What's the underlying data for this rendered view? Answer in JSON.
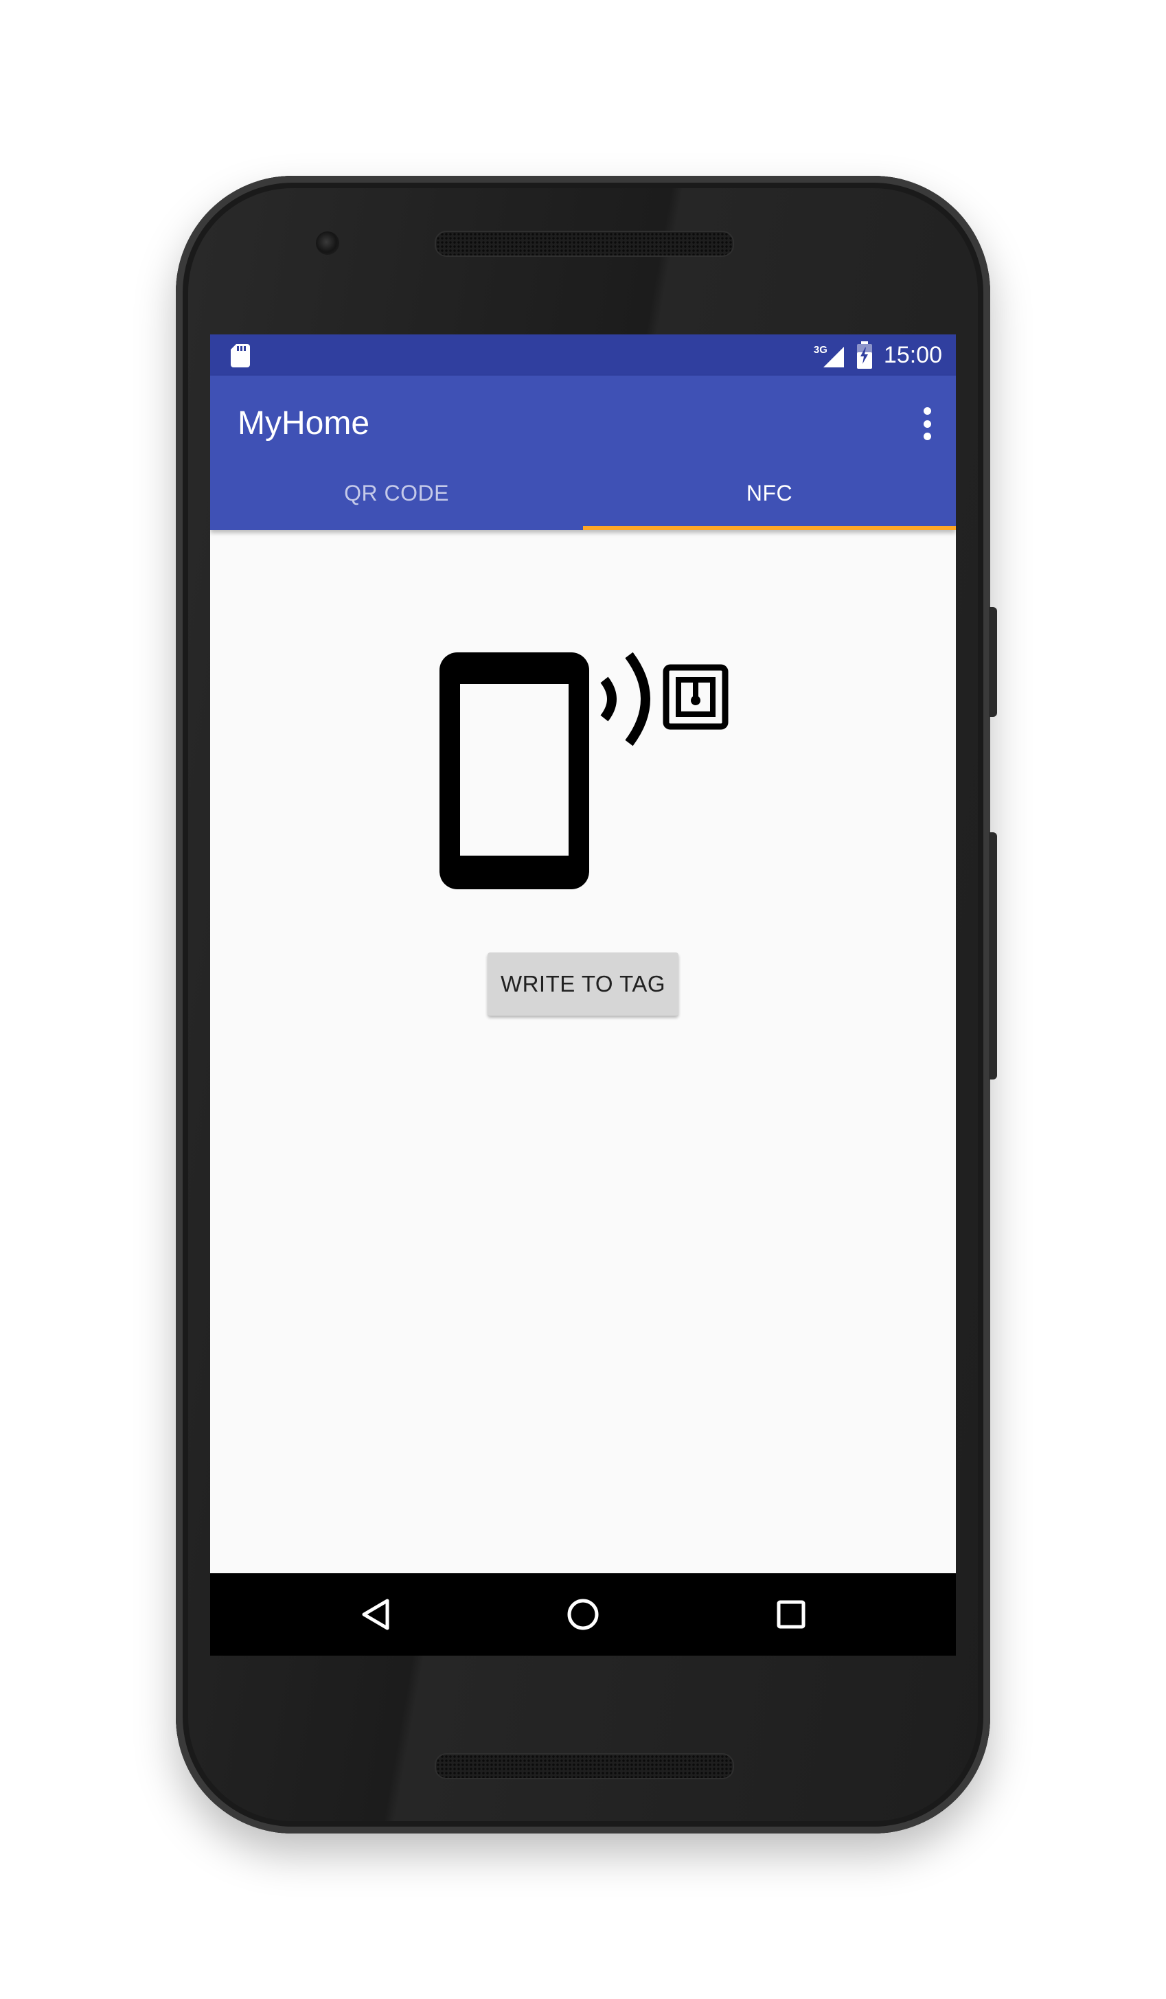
{
  "status_bar": {
    "network_type": "3G",
    "time": "15:00",
    "icons": [
      "sd-card-icon",
      "signal-icon",
      "battery-icon"
    ]
  },
  "app_bar": {
    "title": "MyHome",
    "menu_icon": "overflow-menu-icon"
  },
  "tabs": [
    {
      "label": "QR CODE",
      "active": false
    },
    {
      "label": "NFC",
      "active": true
    }
  ],
  "content": {
    "illustration_icon": "nfc-phone-tag-icon",
    "write_button_label": "WRITE TO TAG"
  },
  "nav_bar": {
    "icons": [
      "back-icon",
      "home-icon",
      "recents-icon"
    ]
  },
  "colors": {
    "status_bar": "#303f9f",
    "primary": "#3f51b5",
    "tab_indicator": "#ffa726",
    "background": "#fafafa",
    "button": "#d6d6d6"
  }
}
